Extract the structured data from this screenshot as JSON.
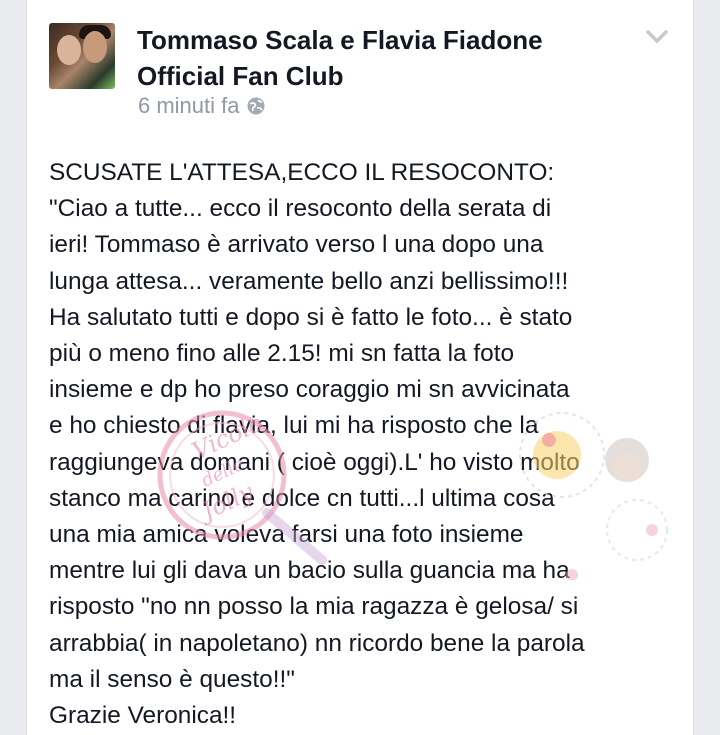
{
  "post": {
    "page_name": "Tommaso Scala e Flavia Fiadone Official Fan Club",
    "timestamp": "6 minuti fa",
    "privacy_icon": "globe-icon",
    "options_icon": "chevron-down-icon",
    "text": "SCUSATE L'ATTESA,ECCO IL RESOCONTO:\n\"Ciao a tutte... ecco il resoconto della serata di\nieri! Tommaso è arrivato verso l una dopo una\nlunga attesa... veramente bello anzi bellissimo!!!\nHa salutato tutti e dopo si è fatto le foto... è stato\npiù o meno fino alle 2.15! mi sn fatta la foto\ninsieme e dp ho preso coraggio mi sn avvicinata\ne ho chiesto di flavia, lui mi ha risposto che la\nraggiungeva domani ( cioè oggi).L' ho visto molto\nstanco ma carino e dolce cn tutti...l ultima cosa\nuna mia amica voleva farsi una foto insieme\nmentre lui gli dava un bacio sulla guancia ma ha\nrisposto \"no nn posso la mia ragazza è gelosa/ si\narrabbia( in napoletano) nn ricordo bene la parola\nma il senso è questo!!\"\nGrazie Veronica!!"
  },
  "watermark": {
    "lines": [
      "Vicolo",
      "delle",
      "Jolly"
    ],
    "color": "#e88aa8"
  }
}
